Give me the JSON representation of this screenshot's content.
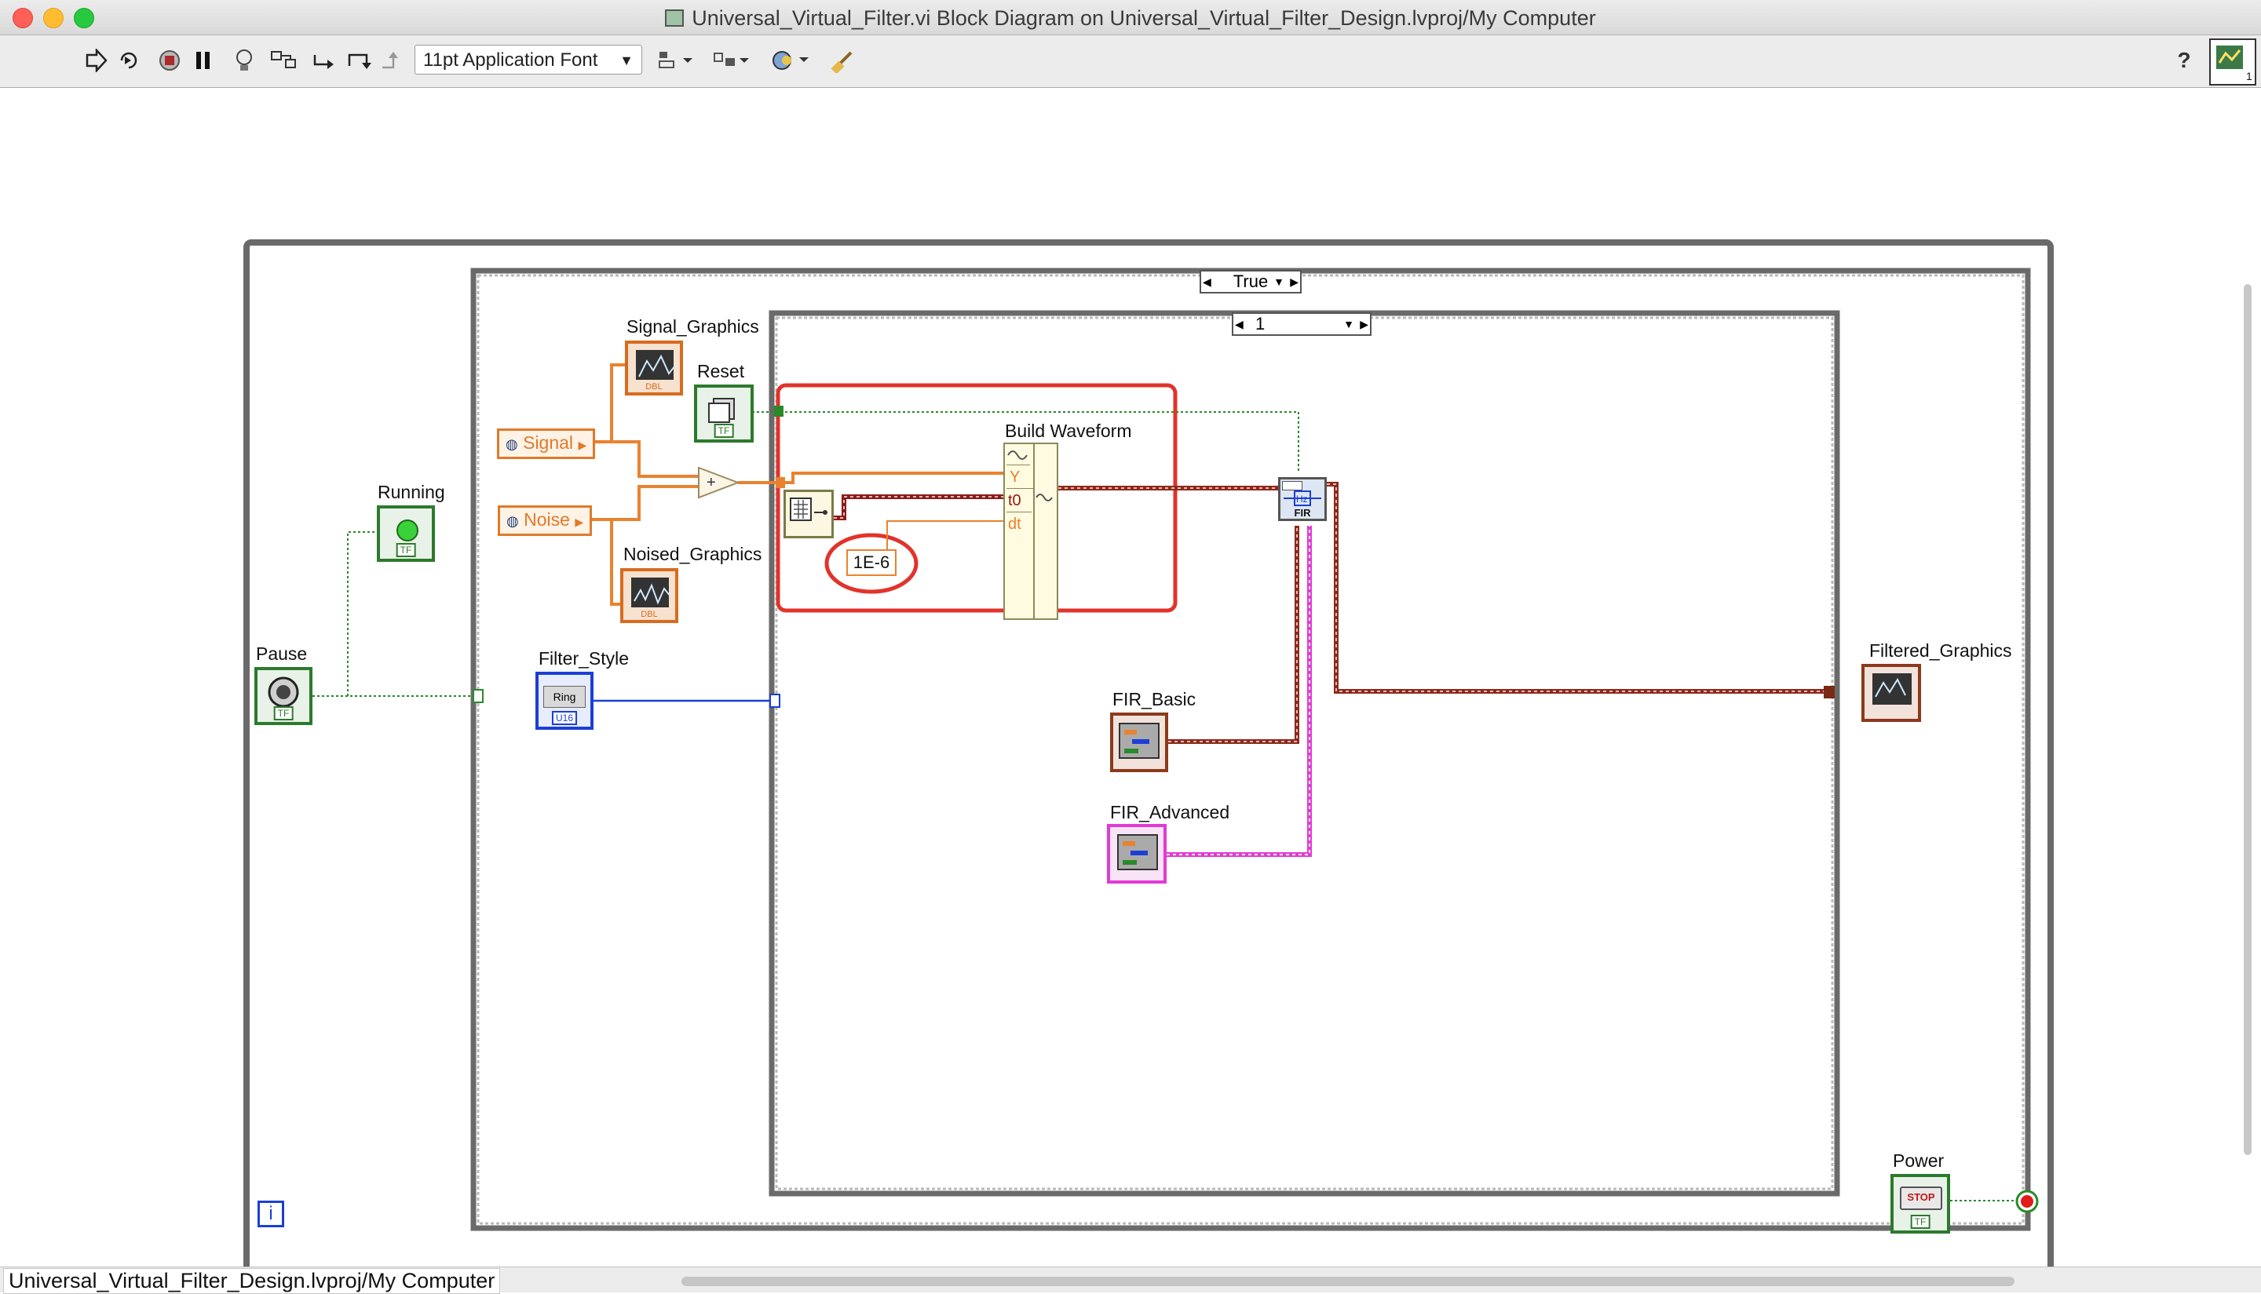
{
  "window": {
    "title": "Universal_Virtual_Filter.vi Block Diagram on Universal_Virtual_Filter_Design.lvproj/My Computer"
  },
  "toolbar": {
    "font_select": "11pt Application Font",
    "run_icon": "run-arrow-icon",
    "help_glyph": "?"
  },
  "diagram": {
    "case_selector_outer": "True",
    "case_selector_inner": "1",
    "loop_iteration": "i",
    "labels": {
      "signal_graphics": "Signal_Graphics",
      "reset": "Reset",
      "running": "Running",
      "noised_graphics": "Noised_Graphics",
      "pause": "Pause",
      "filter_style": "Filter_Style",
      "build_waveform": "Build Waveform",
      "fir_basic": "FIR_Basic",
      "fir_advanced": "FIR_Advanced",
      "filtered_graphics": "Filtered_Graphics",
      "power": "Power"
    },
    "globals": {
      "signal": "Signal",
      "noise": "Noise"
    },
    "build_waveform_terminals": [
      "Y",
      "t0",
      "dt"
    ],
    "constant_dt": "1E-6",
    "fir_label": "FIR",
    "ring_label": "Ring",
    "ring_type": "U16",
    "stop_label": "STOP",
    "bool_type": "TF",
    "dbl_type": "DBL"
  },
  "statusbar": {
    "path": "Universal_Virtual_Filter_Design.lvproj/My Computer"
  }
}
